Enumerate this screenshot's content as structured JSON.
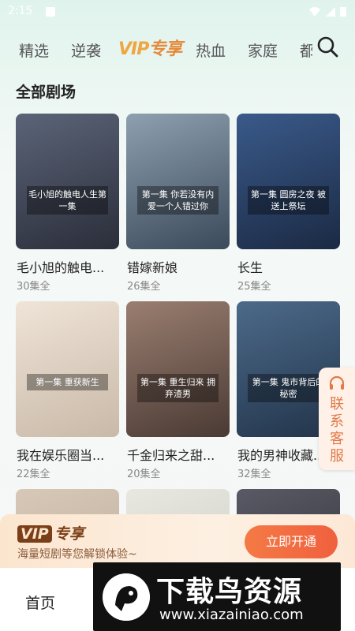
{
  "status_bar": {
    "time": "2:15"
  },
  "tabs": [
    {
      "label": "精选"
    },
    {
      "label": "逆袭"
    },
    {
      "label_v": "VIP",
      "label_rest": "专享",
      "active": true
    },
    {
      "label": "热血"
    },
    {
      "label": "家庭"
    },
    {
      "label": "都"
    }
  ],
  "section_title": "全部剧场",
  "dramas": [
    {
      "title": "毛小旭的触电...",
      "count": "30集全",
      "caption": "毛小旭的触电人生第一集",
      "colors": [
        "#2b2e3a",
        "#5b6478"
      ]
    },
    {
      "title": "错嫁新娘",
      "count": "26集全",
      "caption": "第一集 你若没有内爱一个人错过你",
      "colors": [
        "#3b4a5a",
        "#8ea0b0"
      ]
    },
    {
      "title": "长生",
      "count": "25集全",
      "caption": "第一集 圆房之夜 被送上祭坛",
      "colors": [
        "#1b2a44",
        "#3a5a8a"
      ]
    },
    {
      "title": "我在娱乐圈当...",
      "count": "22集全",
      "caption": "第一集 重获新生",
      "colors": [
        "#c9b9a8",
        "#efe4d8"
      ]
    },
    {
      "title": "千金归来之甜...",
      "count": "20集全",
      "caption": "第一集 重生归来 拥弃渣男",
      "colors": [
        "#4a3a34",
        "#9a7e70"
      ]
    },
    {
      "title": "我的男神收藏...",
      "count": "32集全",
      "caption": "第一集 鬼市背后的秘密",
      "colors": [
        "#22344a",
        "#4c6a8a"
      ]
    },
    {
      "title": "",
      "count": "",
      "caption": "",
      "colors": [
        "#b8a898",
        "#d8c8b8"
      ]
    },
    {
      "title": "",
      "count": "",
      "caption": "",
      "colors": [
        "#c8c8c0",
        "#e8e8e0"
      ]
    },
    {
      "title": "",
      "count": "",
      "caption": "",
      "colors": [
        "#2a2a30",
        "#5a5a66"
      ]
    }
  ],
  "customer_service": {
    "label": "联系客服"
  },
  "vip_banner": {
    "logo_v": "VIP",
    "logo_rest": "专享",
    "subtitle": "海量短剧等您解锁体验~",
    "button": "立即开通"
  },
  "bottom_nav": {
    "home": "首页"
  },
  "watermark": {
    "title": "下载鸟资源",
    "url": "www.xiazainiao.com"
  },
  "colors": {
    "accent": "#f0603e",
    "vip_brown": "#7b3f17",
    "bg_mint": "#dff3ec"
  }
}
